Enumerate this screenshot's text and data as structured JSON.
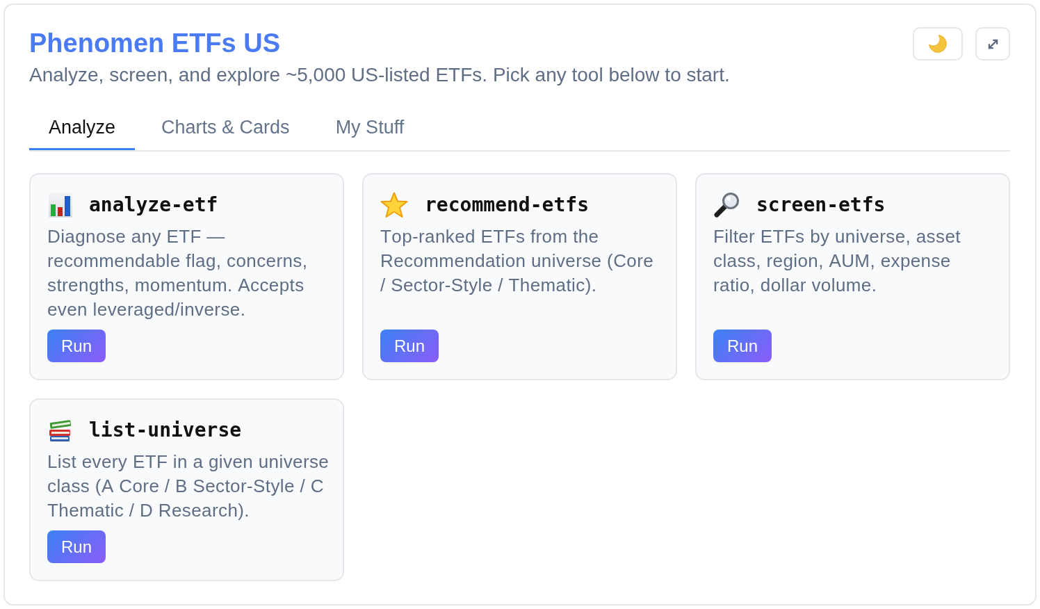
{
  "header": {
    "title": "Phenomen ETFs US",
    "subtitle": "Analyze, screen, and explore ~5,000 US-listed ETFs. Pick any tool below to start."
  },
  "tabs": [
    {
      "label": "Analyze",
      "selected": true
    },
    {
      "label": "Charts & Cards",
      "selected": false
    },
    {
      "label": "My Stuff",
      "selected": false
    }
  ],
  "tools": [
    {
      "name": "analyze-etf",
      "description": "Diagnose any ETF — recommendable flag, concerns, strengths, momentum. Accepts even leveraged/inverse.",
      "button": "Run"
    },
    {
      "name": "recommend-etfs",
      "description": "Top-ranked ETFs from the Recommendation universe (Core / Sector-Style / Thematic).",
      "button": "Run"
    },
    {
      "name": "screen-etfs",
      "description": "Filter ETFs by universe, asset class, region, AUM, expense ratio, dollar volume.",
      "button": "Run"
    },
    {
      "name": "list-universe",
      "description": "List every ETF in a given universe class (A Core / B Sector-Style / C Thematic / D Research).",
      "button": "Run"
    }
  ]
}
